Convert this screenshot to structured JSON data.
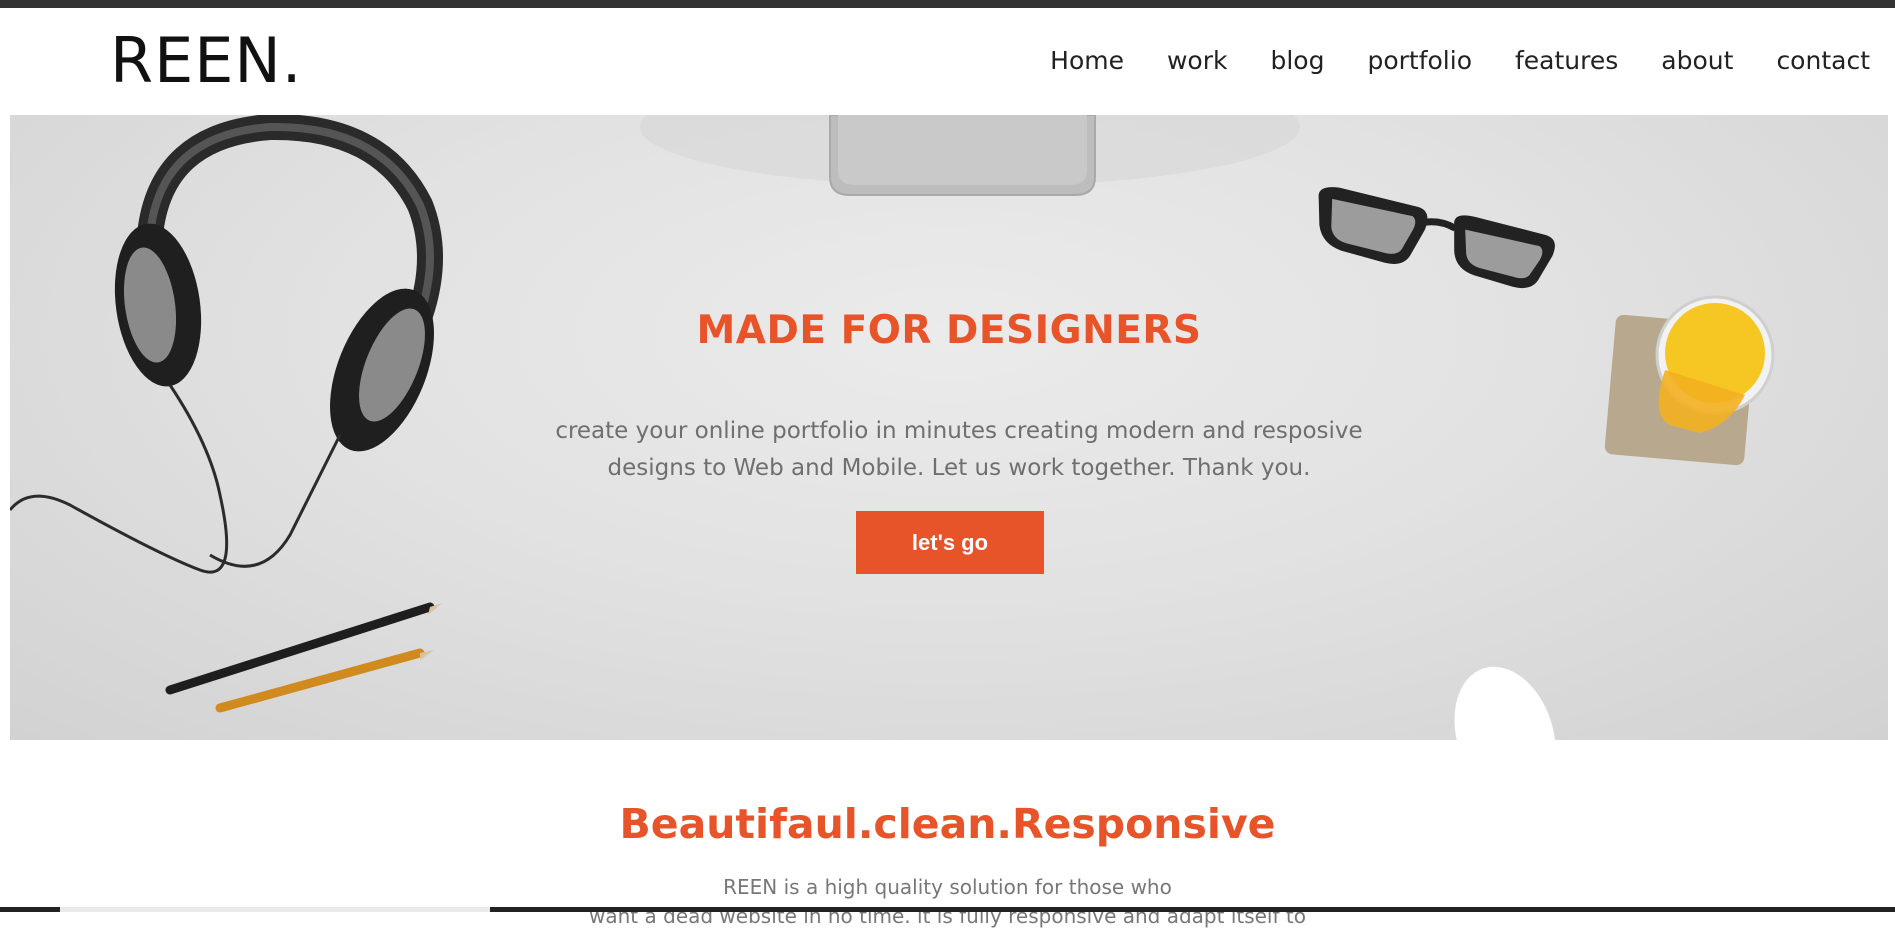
{
  "brand": {
    "logo": "REEN."
  },
  "nav": {
    "items": [
      {
        "label": "Home"
      },
      {
        "label": "work"
      },
      {
        "label": "blog"
      },
      {
        "label": "portfolio"
      },
      {
        "label": "features"
      },
      {
        "label": "about"
      },
      {
        "label": "contact"
      }
    ]
  },
  "hero": {
    "title": "MADE FOR DESIGNERS",
    "text_line1": "create your online portfolio in minutes creating modern and resposive",
    "text_line2": "designs to Web and Mobile. Let us work together. Thank you.",
    "button_label": "let's go"
  },
  "section": {
    "title": "Beautifaul.clean.Responsive",
    "text_line1": "REEN is a high quality solution for those who",
    "text_line2": "want a dead website in no time. it is fully responsive and adapt itself to"
  },
  "colors": {
    "accent": "#e8542a",
    "topbar": "#333333",
    "text_muted": "#6f6f6f"
  },
  "icons": {
    "hero_objects": [
      "headphones-icon",
      "monitor-stand-icon",
      "eyeglasses-icon",
      "juice-glass-icon",
      "pencils-icon",
      "mouse-icon"
    ]
  }
}
